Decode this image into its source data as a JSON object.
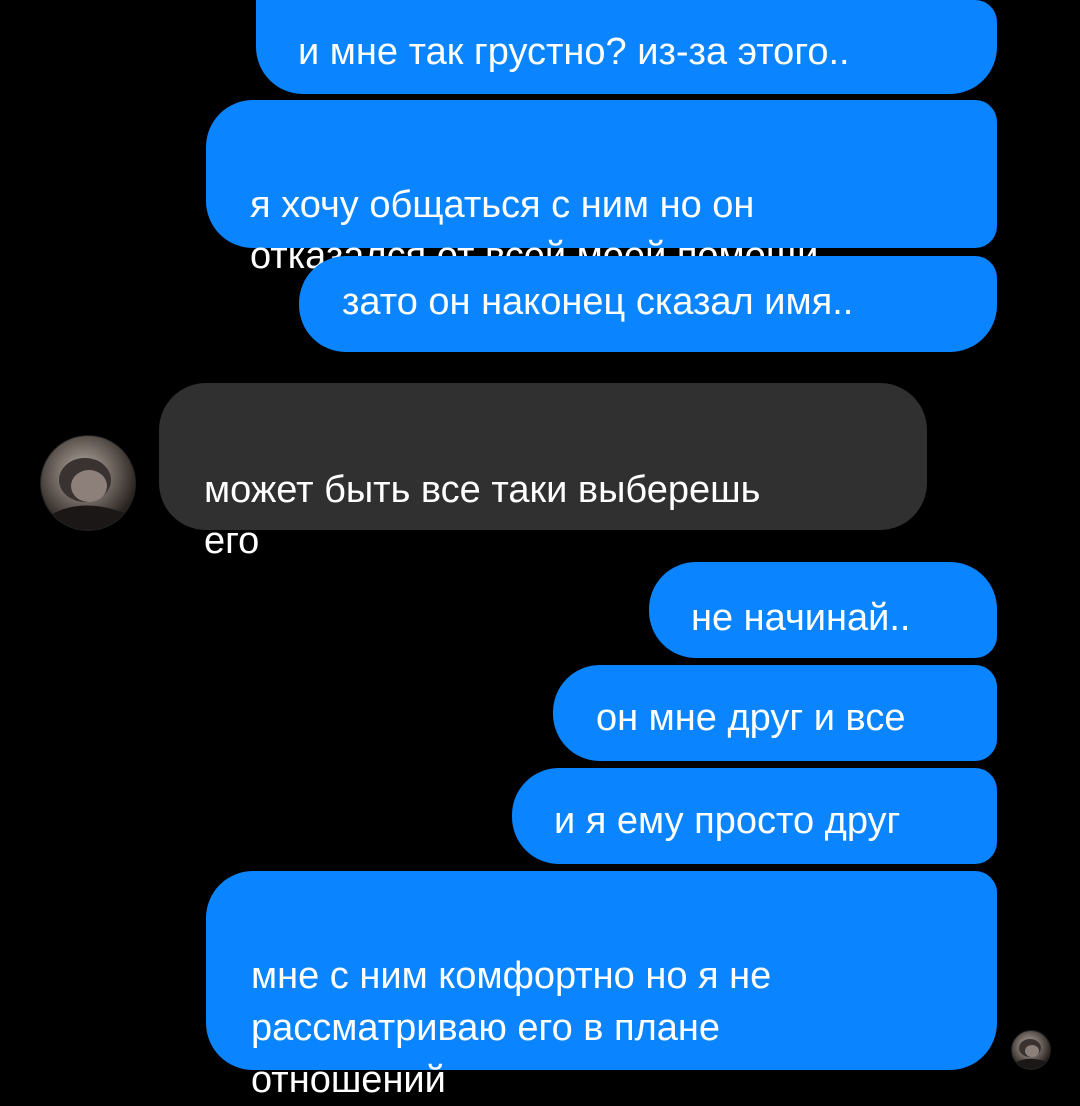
{
  "conversation": {
    "messages": [
      {
        "sender": "me",
        "text": "и мне так грустно? из-за этого.."
      },
      {
        "sender": "me",
        "text": "я хочу общаться с ним но он\nотказался от всей моей помощи"
      },
      {
        "sender": "me",
        "text": "зато он наконец сказал имя.."
      },
      {
        "sender": "them",
        "text": "может быть все таки выберешь\nего"
      },
      {
        "sender": "me",
        "text": "не начинай.."
      },
      {
        "sender": "me",
        "text": "он мне друг и все"
      },
      {
        "sender": "me",
        "text": "и я ему просто друг"
      },
      {
        "sender": "me",
        "text": "мне с ним комфортно но я не\nрассматриваю его в плане\nотношений"
      }
    ]
  },
  "colors": {
    "background": "#000000",
    "outgoing_bubble": "#0a84ff",
    "incoming_bubble": "#303030",
    "text": "#ffffff"
  },
  "icons": {
    "contact_avatar": "contact-avatar-icon",
    "read_receipt_avatar": "read-receipt-avatar-icon"
  }
}
